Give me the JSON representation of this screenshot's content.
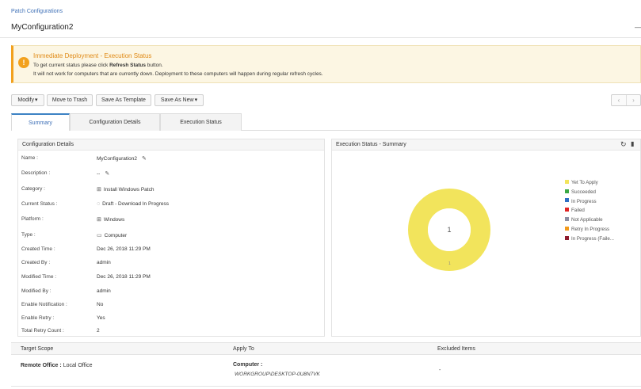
{
  "breadcrumb": "Patch Configurations",
  "title": "MyConfiguration2",
  "banner": {
    "title": "Immediate Deployment - Execution Status",
    "line1_pre": "To get current status please click ",
    "line1_bold": "Refresh Status",
    "line1_post": " button.",
    "line2": "It will not work for computers that are currently down. Deployment to these computers will happen during regular refresh cycles.",
    "icon": "warning-icon"
  },
  "toolbar": {
    "modify": "Modify",
    "move_to_trash": "Move to Trash",
    "save_as_template": "Save As Template",
    "save_as_new": "Save As New",
    "prev": "‹",
    "next": "›"
  },
  "tabs": [
    "Summary",
    "Configuration Details",
    "Execution Status"
  ],
  "details": {
    "heading": "Configuration Details",
    "rows": [
      {
        "label": "Name :",
        "value": "MyConfiguration2"
      },
      {
        "label": "Description :",
        "value": "--"
      },
      {
        "label": "Category :",
        "value": "Install Windows Patch"
      },
      {
        "label": "Current Status :",
        "value": "Draft - Download In Progress"
      },
      {
        "label": "Platform :",
        "value": "Windows"
      },
      {
        "label": "Type :",
        "value": "Computer"
      },
      {
        "label": "Created Time :",
        "value": "Dec 26, 2018 11:29 PM"
      },
      {
        "label": "Created By :",
        "value": "admin"
      },
      {
        "label": "Modified Time :",
        "value": "Dec 26, 2018 11:29 PM"
      },
      {
        "label": "Modified By :",
        "value": "admin"
      },
      {
        "label": "Enable Notification :",
        "value": "No"
      },
      {
        "label": "Enable Retry :",
        "value": "Yes"
      },
      {
        "label": "Total Retry Count :",
        "value": "2"
      }
    ]
  },
  "execution": {
    "heading": "Execution Status - Summary",
    "center_label": "1",
    "below_label": "1",
    "legend": [
      {
        "label": "Yet To Apply",
        "color": "#f2e45c"
      },
      {
        "label": "Succeeded",
        "color": "#3aa845"
      },
      {
        "label": "In Progress",
        "color": "#2f6fc4"
      },
      {
        "label": "Failed",
        "color": "#e02424"
      },
      {
        "label": "Not Applicable",
        "color": "#8c8fa3"
      },
      {
        "label": "Retry In Progress",
        "color": "#f29a1c"
      },
      {
        "label": "In Progress (Faile...",
        "color": "#8e1b2e"
      }
    ]
  },
  "chart_data": {
    "type": "pie",
    "categories": [
      "Yet To Apply",
      "Succeeded",
      "In Progress",
      "Failed",
      "Not Applicable",
      "Retry In Progress",
      "In Progress (Faile..."
    ],
    "values": [
      1,
      0,
      0,
      0,
      0,
      0,
      0
    ],
    "title": "Execution Status - Summary",
    "legend": "right"
  },
  "scope": {
    "headers": [
      "Target Scope",
      "Apply To",
      "Excluded Items"
    ],
    "target_label": "Remote Office :",
    "target_value": "Local Office",
    "apply_label": "Computer :",
    "apply_value": "WORKGROUP\\DESKTOP-0U8N7VK",
    "excluded": "-"
  }
}
